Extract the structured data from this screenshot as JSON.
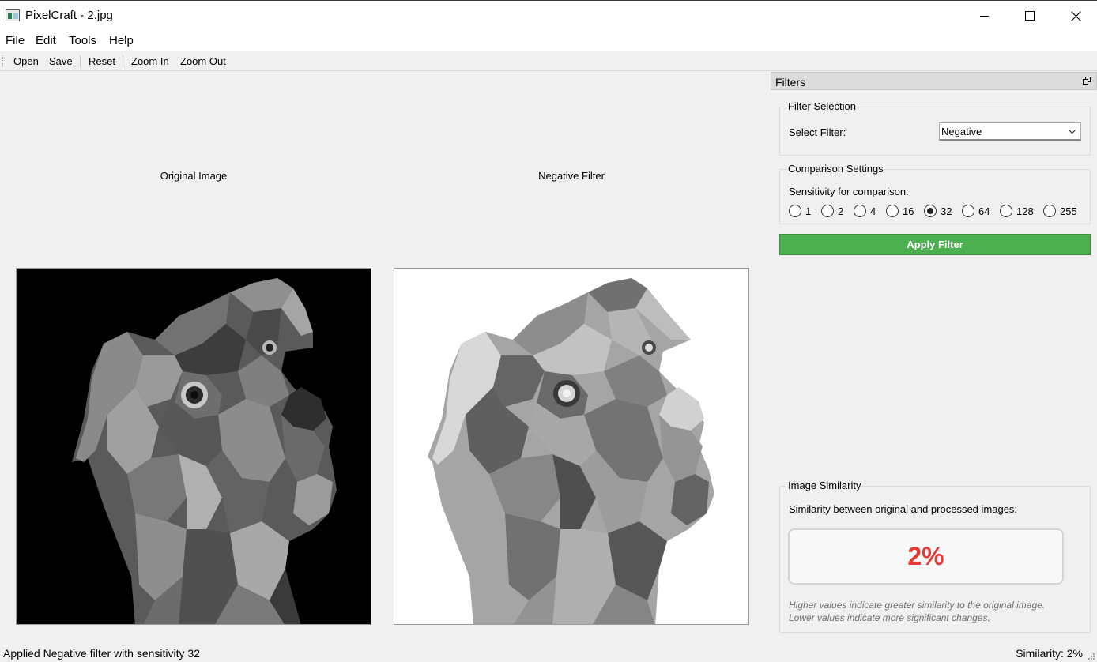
{
  "window": {
    "title": "PixelCraft - 2.jpg"
  },
  "menu": {
    "items": [
      "File",
      "Edit",
      "Tools",
      "Help"
    ]
  },
  "toolbar": {
    "open": "Open",
    "save": "Save",
    "reset": "Reset",
    "zoom_in": "Zoom In",
    "zoom_out": "Zoom Out"
  },
  "images": {
    "original_label": "Original Image",
    "processed_label": "Negative Filter"
  },
  "filters_panel": {
    "title": "Filters",
    "filter_selection": {
      "title": "Filter Selection",
      "label": "Select Filter:",
      "selected": "Negative"
    },
    "comparison": {
      "title": "Comparison Settings",
      "label": "Sensitivity for comparison:",
      "options": [
        "1",
        "2",
        "4",
        "16",
        "32",
        "64",
        "128",
        "255"
      ],
      "selected": "32"
    },
    "apply_button": "Apply Filter",
    "similarity": {
      "title": "Image Similarity",
      "label": "Similarity between original and processed images:",
      "value": "2%",
      "note_line1": "Higher values indicate greater similarity to the original image.",
      "note_line2": "Lower values indicate more significant changes."
    }
  },
  "status": {
    "message": "Applied Negative filter with sensitivity 32",
    "similarity": "Similarity: 2%"
  },
  "colors": {
    "accent_green": "#4caf50",
    "similarity_red": "#e53935"
  },
  "icons": [
    "app-icon",
    "minimize-icon",
    "maximize-icon",
    "close-icon",
    "dock-float-icon",
    "chevron-down-icon",
    "size-grip-icon"
  ]
}
